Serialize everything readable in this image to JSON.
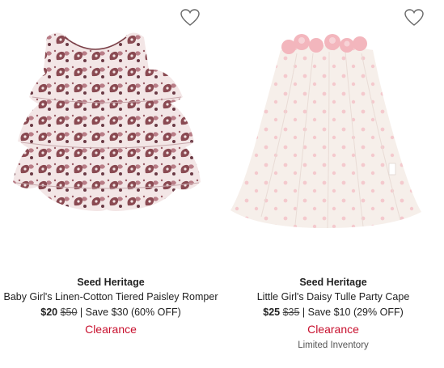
{
  "products": [
    {
      "image_alt": "Paisley tiered romper",
      "brand": "Seed Heritage",
      "name": "Baby Girl's Linen-Cotton Tiered Paisley Romper",
      "price_now": "$20",
      "price_was": "$50",
      "savings": " | Save $30 (60% OFF)",
      "status": "Clearance",
      "favorite_icon": "heart-outline-icon"
    },
    {
      "image_alt": "Daisy tulle party cape",
      "brand": "Seed Heritage",
      "name": "Little Girl's Daisy Tulle Party Cape",
      "price_now": "$25",
      "price_was": "$35",
      "savings": " | Save $10 (29% OFF)",
      "status": "Clearance",
      "inventory": "Limited Inventory",
      "favorite_icon": "heart-outline-icon"
    }
  ],
  "colors": {
    "clearance": "#c8102e",
    "text": "#222222",
    "muted": "#555555"
  }
}
